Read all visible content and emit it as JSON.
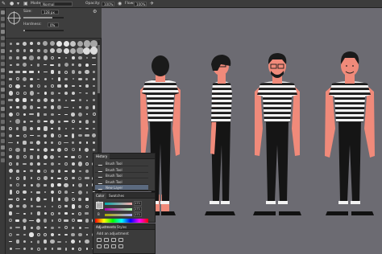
{
  "options_bar": {
    "mode_label": "Mode:",
    "mode_value": "Normal",
    "opacity_label": "Opacity:",
    "opacity_value": "100%",
    "flow_label": "Flow:",
    "flow_value": "100%"
  },
  "brush_panel": {
    "size_label": "Size:",
    "size_value": "128 px",
    "hardness_label": "Hardness:",
    "hardness_value": "0%"
  },
  "history_panel": {
    "tab": "History",
    "items": [
      {
        "label": "Brush Tool",
        "selected": false
      },
      {
        "label": "Brush Tool",
        "selected": false
      },
      {
        "label": "Brush Tool",
        "selected": false
      },
      {
        "label": "Brush Tool",
        "selected": false
      },
      {
        "label": "New Layer",
        "selected": true
      }
    ]
  },
  "color_panel": {
    "tabs": [
      "Color",
      "Swatches"
    ],
    "channels": [
      {
        "label": "R",
        "value": "171"
      },
      {
        "label": "G",
        "value": "171"
      },
      {
        "label": "B",
        "value": "171"
      }
    ],
    "foreground": "#ababab"
  },
  "adjustments_panel": {
    "tabs": [
      "Adjustments",
      "Styles"
    ],
    "title": "Add an adjustment"
  },
  "colors": {
    "canvas_bg": "#6c6b72",
    "shirt_white": "#f2f2f2",
    "stripe_black": "#1c1c1c",
    "skin": "#f08a7a",
    "hair": "#1a1a1a",
    "pants": "#151515",
    "panel_bg": "#3b3b3b",
    "selection": "#5b6a7f"
  }
}
